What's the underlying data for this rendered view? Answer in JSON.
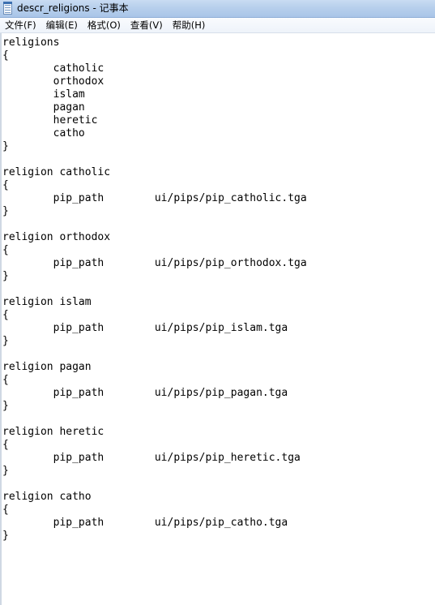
{
  "window": {
    "title": "descr_religions - 记事本"
  },
  "menu": {
    "items": [
      "文件(F)",
      "编辑(E)",
      "格式(O)",
      "查看(V)",
      "帮助(H)"
    ]
  },
  "editor": {
    "content": "religions\n{\n\tcatholic\n\torthodox\n\tislam\n\tpagan\n\theretic\n\tcatho\n}\n\nreligion catholic\n{\n\tpip_path\tui/pips/pip_catholic.tga\n}\n\nreligion orthodox\n{\n\tpip_path\tui/pips/pip_orthodox.tga\n}\n\nreligion islam\n{\n\tpip_path\tui/pips/pip_islam.tga\n}\n\nreligion pagan\n{\n\tpip_path\tui/pips/pip_pagan.tga\n}\n\nreligion heretic\n{\n\tpip_path\tui/pips/pip_heretic.tga\n}\n\nreligion catho\n{\n\tpip_path\tui/pips/pip_catho.tga\n}"
  }
}
